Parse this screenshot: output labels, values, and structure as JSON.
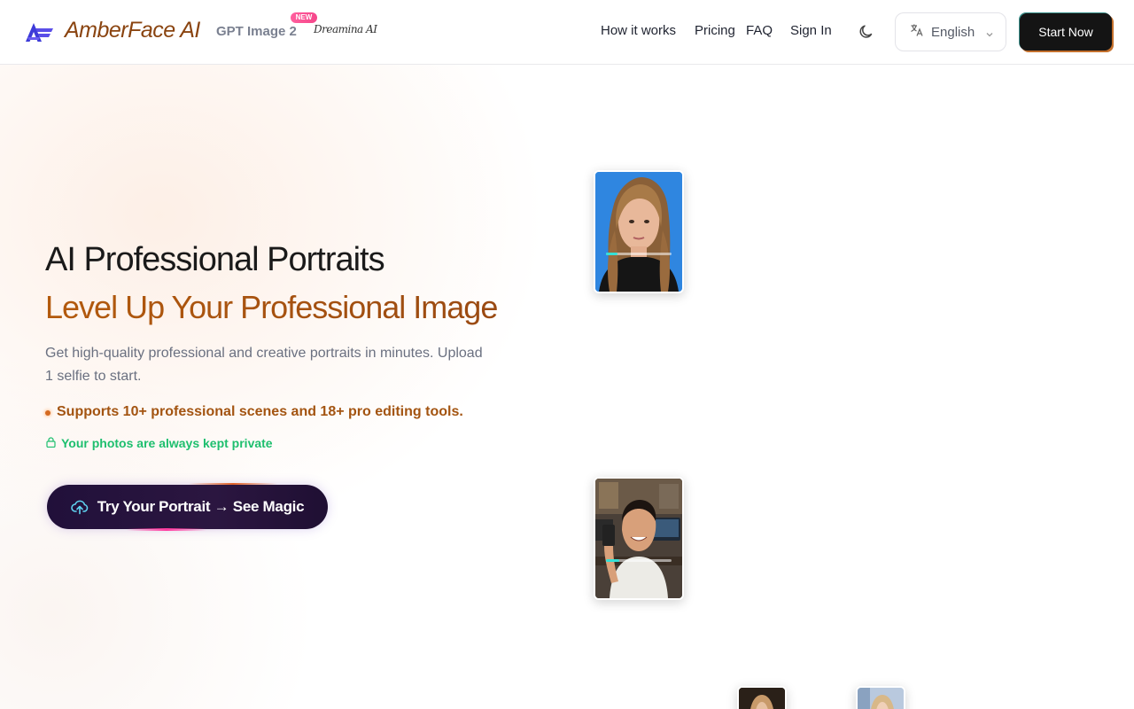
{
  "header": {
    "brand": "AmberFace AI",
    "gpt_link": "GPT Image 2",
    "new_badge": "NEW",
    "partner": "Dreamina AI",
    "nav": {
      "how_it_works": "How it works",
      "pricing": "Pricing",
      "faq": "FAQ",
      "sign_in": "Sign In"
    },
    "language": "English",
    "start_now": "Start Now"
  },
  "hero": {
    "title": "AI Professional Portraits",
    "subtitle": "Level Up Your Professional Image",
    "description": "Get high-quality professional and creative portraits in minutes. Upload 1 selfie to start.",
    "feature": "Supports 10+ professional scenes and 18+ pro editing tools.",
    "privacy": "Your photos are always kept private",
    "cta": "Try Your Portrait → See Magic"
  },
  "colors": {
    "brand_text": "#8a4410",
    "accent_orange": "#a35411",
    "privacy_green": "#1dbf6e",
    "cta_bg": "#21103a",
    "progress_fill": "#35e0d6"
  },
  "cards": [
    {
      "progress": 0.18
    },
    {
      "progress": 0.2
    }
  ]
}
